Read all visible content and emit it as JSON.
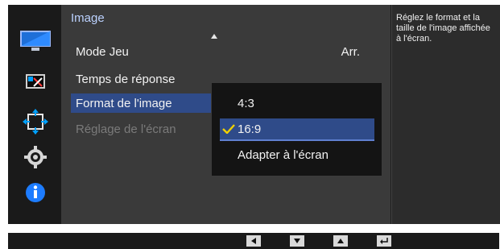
{
  "menu": {
    "title": "Image",
    "items": [
      {
        "label": "Mode Jeu",
        "value": "Arr."
      },
      {
        "label": "Temps de réponse",
        "value": ""
      },
      {
        "label": "Format de l'image",
        "value": ""
      },
      {
        "label": "Réglage de l'écran",
        "value": ""
      }
    ]
  },
  "submenu": {
    "options": [
      "4:3",
      "16:9",
      "Adapter à l'écran"
    ],
    "selected": "16:9"
  },
  "help": {
    "text": "Réglez le format et la taille de l'image affichée à l'écran."
  },
  "icons": {
    "left": [
      "monitor-icon",
      "color-picture-icon",
      "resize-arrows-icon",
      "settings-gear-icon",
      "info-icon"
    ]
  },
  "bottom": {
    "buttons": [
      "left-arrow-icon",
      "down-arrow-icon",
      "up-arrow-icon",
      "return-icon"
    ]
  },
  "colors": {
    "accent": "#2f4b89",
    "panel": "#3a3a3a",
    "background": "#1c1c1c",
    "title": "#bcd2ff",
    "check": "#f0d000"
  }
}
